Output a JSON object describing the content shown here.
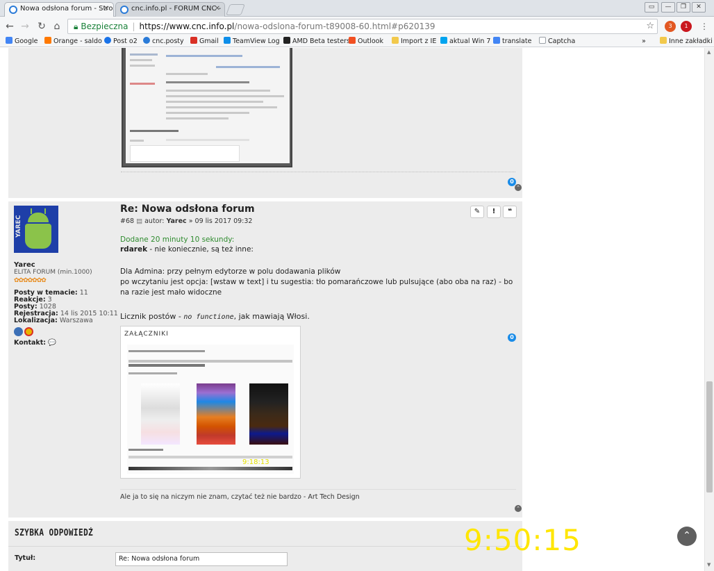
{
  "browser": {
    "tabs": [
      {
        "label": "Nowa odsłona forum - Stroi"
      },
      {
        "label": "cnc.info.pl - FORUM CNC -"
      }
    ],
    "window_controls": [
      "▭",
      "—",
      "❐",
      "✕"
    ],
    "url": {
      "secure_label": "Bezpieczna",
      "host": "https://www.cnc.info.pl",
      "path": "/nowa-odslona-forum-t89008-60.html#p620139"
    },
    "extensions": [
      {
        "badge": "3"
      },
      {
        "badge": "1"
      }
    ],
    "bookmarks": [
      {
        "label": "Google",
        "color": "#4285f4"
      },
      {
        "label": "Orange - saldo",
        "color": "#ff7900"
      },
      {
        "label": "Post o2",
        "color": "#1a73e8"
      },
      {
        "label": "cnc.posty",
        "color": "#2a7bd8"
      },
      {
        "label": "Gmail",
        "color": "#d93025"
      },
      {
        "label": "TeamView Log",
        "color": "#0e8ee9"
      },
      {
        "label": "AMD Beta testers",
        "color": "#222222"
      },
      {
        "label": "Outlook",
        "color": "#f25022"
      },
      {
        "label": "Import z IE",
        "color": "#f2c94c"
      },
      {
        "label": "aktual Win 7",
        "color": "#00a4ef"
      },
      {
        "label": "translate",
        "color": "#4285f4"
      },
      {
        "label": "Captcha",
        "color": "#9aa0a6"
      }
    ],
    "bookmarks_more": "»",
    "other_bookmarks": "Inne zakładki"
  },
  "post_prev": {
    "likes": "0"
  },
  "post": {
    "title": "Re: Nowa odsłona forum",
    "meta_num": "#68",
    "meta_author_label": "autor:",
    "meta_author": "Yarec",
    "meta_date": "» 09 lis 2017 09:32",
    "actions": [
      "✎",
      "!",
      "❝"
    ],
    "user": {
      "name": "Yarec",
      "rank": "ELITA FORUM (min.1000)",
      "stars": "✿✿✿✿✿✿✿",
      "avatar_text": "YAREC",
      "stats": [
        {
          "k": "Posty w temacie:",
          "v": "11"
        },
        {
          "k": "Reakcje:",
          "v": "3"
        },
        {
          "k": "Posty:",
          "v": "1028"
        },
        {
          "k": "Rejestracja:",
          "v": "14 lis 2015 10:11"
        },
        {
          "k": "Lokalizacja:",
          "v": "Warszawa"
        }
      ],
      "contact_label": "Kontakt:",
      "contact_icon": "💬"
    },
    "added_line": "Dodane 20 minuty 10 sekundy:",
    "line1_bold": "rdarek",
    "line1_rest": " - nie koniecznie, są też inne:",
    "para2_line1": "Dla Admina: przy pełnym edytorze w polu dodawania plików",
    "para2_line2": "po wczytaniu jest opcja: [wstaw w text] i tu sugestia: tło pomarańczowe lub pulsujące (abo oba na raz) - bo na razie jest mało widoczne",
    "para3_pre": "Licznik postów - ",
    "para3_em": "no functione",
    "para3_post": ", jak mawiają Włosi.",
    "likes": "0",
    "attachment_title": "ZAŁĄCZNIKI",
    "attachment_clock": "9:18:13",
    "signature": "Ale ja to się na niczym nie znam, czytać też nie bardzo - Art Tech Design"
  },
  "quick_reply": {
    "title": "SZYBKA ODPOWIEDŹ",
    "subject_label": "Tytuł:",
    "subject_value": "Re: Nowa odsłona forum"
  },
  "overlay_clock": "9:50:15",
  "scroll_top_icon": "⌃"
}
